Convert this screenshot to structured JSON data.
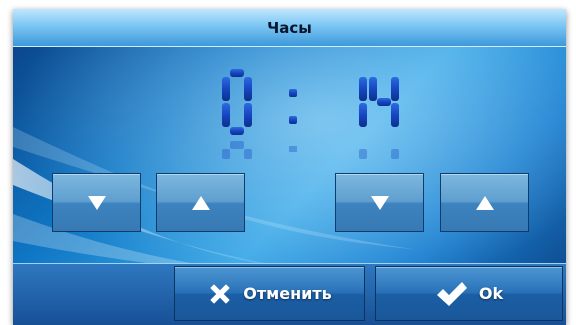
{
  "window": {
    "title": "Часы"
  },
  "clock": {
    "hours_tens": "",
    "hours_ones": "0",
    "separator": ":",
    "minutes_tens": "1",
    "minutes_ones": "4",
    "digit_color": "#1646c0"
  },
  "hour_controls": {
    "decrease_icon": "triangle-down-icon",
    "increase_icon": "triangle-up-icon"
  },
  "minute_controls": {
    "decrease_icon": "triangle-down-icon",
    "increase_icon": "triangle-up-icon"
  },
  "actions": {
    "cancel_label": "Отменить",
    "cancel_icon": "x-icon",
    "ok_label": "Ok",
    "ok_icon": "checkmark-icon"
  },
  "colors": {
    "title_bar": "#7cc6f3",
    "background": "#1b7fd0",
    "button": "#5f9fcf"
  }
}
